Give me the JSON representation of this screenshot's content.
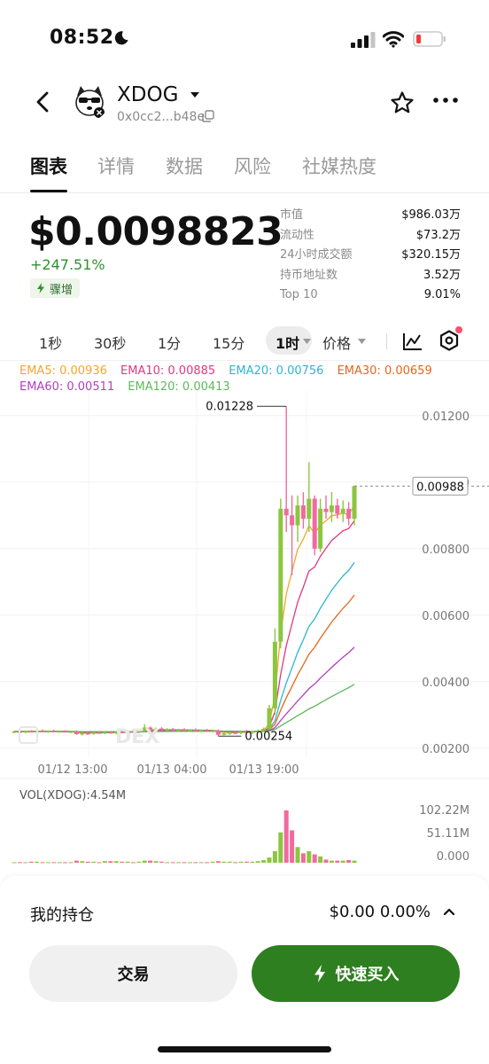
{
  "status_bar": {
    "time": "08:52"
  },
  "header": {
    "token_name": "XDOG",
    "address": "0x0cc2...b48e"
  },
  "tabs": [
    {
      "label": "图表",
      "active": true
    },
    {
      "label": "详情",
      "active": false
    },
    {
      "label": "数据",
      "active": false
    },
    {
      "label": "风险",
      "active": false
    },
    {
      "label": "社媒热度",
      "active": false
    }
  ],
  "price": {
    "value": "$0.0098823",
    "change": "+247.51%",
    "badge": "骤增"
  },
  "stats": [
    {
      "label": "市值",
      "value": "$986.03万"
    },
    {
      "label": "流动性",
      "value": "$73.2万"
    },
    {
      "label": "24小时成交额",
      "value": "$320.15万"
    },
    {
      "label": "持币地址数",
      "value": "3.52万"
    },
    {
      "label": "Top 10",
      "value": "9.01%"
    }
  ],
  "intervals": [
    "1秒",
    "30秒",
    "1分",
    "15分",
    "1时"
  ],
  "selected_interval": "1时",
  "price_mode": "价格",
  "ema_legend": [
    {
      "label": "EMA5: 0.00936",
      "color": "#f2a62a"
    },
    {
      "label": "EMA10: 0.00885",
      "color": "#e2387e"
    },
    {
      "label": "EMA20: 0.00756",
      "color": "#2bb7d0"
    },
    {
      "label": "EMA30: 0.00659",
      "color": "#e8651a"
    },
    {
      "label": "EMA60: 0.00511",
      "color": "#b13fbd"
    },
    {
      "label": "EMA120: 0.00413",
      "color": "#5fb85a"
    }
  ],
  "chart": {
    "price_axis": [
      "0.01200",
      "0.01000",
      "0.00800",
      "0.00600",
      "0.00400",
      "0.00200"
    ],
    "time_axis": [
      "01/12 13:00",
      "01/13 04:00",
      "01/13 19:00"
    ],
    "high_label": "0.01228",
    "low_label": "0.00254",
    "current_price": "0.00988",
    "watermark": "DEX",
    "vol_label": "VOL(XDOG):4.54M",
    "vol_axis": [
      "102.22M",
      "51.11M",
      "0.000"
    ]
  },
  "chart_data": {
    "type": "candlestick",
    "ylim": [
      0.0017,
      0.0125
    ],
    "price_ticks": [
      0.012,
      0.01,
      0.008,
      0.006,
      0.004,
      0.002
    ],
    "up_color": "#8cc63f",
    "down_color": "#f06aa0",
    "candles": [
      {
        "o": 0.00248,
        "h": 0.00252,
        "l": 0.00245,
        "c": 0.0025,
        "v": 1
      },
      {
        "o": 0.0025,
        "h": 0.00254,
        "l": 0.00246,
        "c": 0.00249,
        "v": 1
      },
      {
        "o": 0.00249,
        "h": 0.00253,
        "l": 0.00245,
        "c": 0.00251,
        "v": 1
      },
      {
        "o": 0.00251,
        "h": 0.00254,
        "l": 0.00247,
        "c": 0.00248,
        "v": 2
      },
      {
        "o": 0.00248,
        "h": 0.00255,
        "l": 0.00247,
        "c": 0.00253,
        "v": 2
      },
      {
        "o": 0.00253,
        "h": 0.00256,
        "l": 0.00249,
        "c": 0.0025,
        "v": 1
      },
      {
        "o": 0.0025,
        "h": 0.00254,
        "l": 0.00246,
        "c": 0.00252,
        "v": 1
      },
      {
        "o": 0.00252,
        "h": 0.00255,
        "l": 0.00248,
        "c": 0.00249,
        "v": 1
      },
      {
        "o": 0.00249,
        "h": 0.00252,
        "l": 0.00246,
        "c": 0.00251,
        "v": 1
      },
      {
        "o": 0.00251,
        "h": 0.00254,
        "l": 0.00247,
        "c": 0.00248,
        "v": 1
      },
      {
        "o": 0.00248,
        "h": 0.00252,
        "l": 0.00245,
        "c": 0.0025,
        "v": 1
      },
      {
        "o": 0.0025,
        "h": 0.00253,
        "l": 0.0024,
        "c": 0.00242,
        "v": 4
      },
      {
        "o": 0.00242,
        "h": 0.00248,
        "l": 0.00238,
        "c": 0.00245,
        "v": 3
      },
      {
        "o": 0.00245,
        "h": 0.0025,
        "l": 0.0024,
        "c": 0.00243,
        "v": 2
      },
      {
        "o": 0.00243,
        "h": 0.00249,
        "l": 0.0024,
        "c": 0.00247,
        "v": 2
      },
      {
        "o": 0.00247,
        "h": 0.0025,
        "l": 0.00243,
        "c": 0.00245,
        "v": 1
      },
      {
        "o": 0.00245,
        "h": 0.00249,
        "l": 0.00242,
        "c": 0.00248,
        "v": 3
      },
      {
        "o": 0.00248,
        "h": 0.00251,
        "l": 0.00244,
        "c": 0.00246,
        "v": 3
      },
      {
        "o": 0.00246,
        "h": 0.0025,
        "l": 0.00242,
        "c": 0.00249,
        "v": 3
      },
      {
        "o": 0.00249,
        "h": 0.00252,
        "l": 0.00245,
        "c": 0.00247,
        "v": 2
      },
      {
        "o": 0.00247,
        "h": 0.00251,
        "l": 0.00244,
        "c": 0.0025,
        "v": 2
      },
      {
        "o": 0.0025,
        "h": 0.00254,
        "l": 0.00246,
        "c": 0.00248,
        "v": 1
      },
      {
        "o": 0.00248,
        "h": 0.00253,
        "l": 0.00245,
        "c": 0.00252,
        "v": 2
      },
      {
        "o": 0.00252,
        "h": 0.00272,
        "l": 0.00248,
        "c": 0.00262,
        "v": 4
      },
      {
        "o": 0.00262,
        "h": 0.00265,
        "l": 0.00252,
        "c": 0.00256,
        "v": 4
      },
      {
        "o": 0.00256,
        "h": 0.00262,
        "l": 0.0025,
        "c": 0.00259,
        "v": 3
      },
      {
        "o": 0.00259,
        "h": 0.00263,
        "l": 0.00252,
        "c": 0.00255,
        "v": 2
      },
      {
        "o": 0.00255,
        "h": 0.0026,
        "l": 0.0025,
        "c": 0.00257,
        "v": 1
      },
      {
        "o": 0.00257,
        "h": 0.00261,
        "l": 0.00252,
        "c": 0.00254,
        "v": 1
      },
      {
        "o": 0.00254,
        "h": 0.00258,
        "l": 0.0025,
        "c": 0.00256,
        "v": 1
      },
      {
        "o": 0.00256,
        "h": 0.0026,
        "l": 0.00251,
        "c": 0.00253,
        "v": 1
      },
      {
        "o": 0.00253,
        "h": 0.00257,
        "l": 0.00249,
        "c": 0.00255,
        "v": 1
      },
      {
        "o": 0.00255,
        "h": 0.00259,
        "l": 0.0025,
        "c": 0.00252,
        "v": 1
      },
      {
        "o": 0.00252,
        "h": 0.00256,
        "l": 0.00248,
        "c": 0.00254,
        "v": 1
      },
      {
        "o": 0.00254,
        "h": 0.00258,
        "l": 0.00249,
        "c": 0.00251,
        "v": 1
      },
      {
        "o": 0.00251,
        "h": 0.00255,
        "l": 0.00247,
        "c": 0.00253,
        "v": 2
      },
      {
        "o": 0.00253,
        "h": 0.00256,
        "l": 0.00236,
        "c": 0.0024,
        "v": 3
      },
      {
        "o": 0.0024,
        "h": 0.0025,
        "l": 0.00238,
        "c": 0.00244,
        "v": 2
      },
      {
        "o": 0.00244,
        "h": 0.0025,
        "l": 0.0024,
        "c": 0.00247,
        "v": 2
      },
      {
        "o": 0.00247,
        "h": 0.00251,
        "l": 0.00242,
        "c": 0.00245,
        "v": 1
      },
      {
        "o": 0.00245,
        "h": 0.00252,
        "l": 0.00242,
        "c": 0.0025,
        "v": 2
      },
      {
        "o": 0.0025,
        "h": 0.00255,
        "l": 0.00244,
        "c": 0.00246,
        "v": 2
      },
      {
        "o": 0.00246,
        "h": 0.00252,
        "l": 0.00242,
        "c": 0.00251,
        "v": 2
      },
      {
        "o": 0.00251,
        "h": 0.00256,
        "l": 0.00246,
        "c": 0.00253,
        "v": 3
      },
      {
        "o": 0.00253,
        "h": 0.00262,
        "l": 0.00248,
        "c": 0.00258,
        "v": 5
      },
      {
        "o": 0.00258,
        "h": 0.0033,
        "l": 0.00255,
        "c": 0.0032,
        "v": 10
      },
      {
        "o": 0.0032,
        "h": 0.0056,
        "l": 0.003,
        "c": 0.0052,
        "v": 22
      },
      {
        "o": 0.0052,
        "h": 0.0095,
        "l": 0.005,
        "c": 0.0092,
        "v": 58
      },
      {
        "o": 0.0092,
        "h": 0.01228,
        "l": 0.0085,
        "c": 0.009,
        "v": 100
      },
      {
        "o": 0.009,
        "h": 0.0096,
        "l": 0.0072,
        "c": 0.0087,
        "v": 62
      },
      {
        "o": 0.0087,
        "h": 0.0096,
        "l": 0.0082,
        "c": 0.0093,
        "v": 30
      },
      {
        "o": 0.0093,
        "h": 0.0097,
        "l": 0.0086,
        "c": 0.0089,
        "v": 18
      },
      {
        "o": 0.0089,
        "h": 0.0106,
        "l": 0.0085,
        "c": 0.0095,
        "v": 22
      },
      {
        "o": 0.0095,
        "h": 0.0096,
        "l": 0.0078,
        "c": 0.008,
        "v": 16
      },
      {
        "o": 0.008,
        "h": 0.0095,
        "l": 0.0079,
        "c": 0.0092,
        "v": 12
      },
      {
        "o": 0.0092,
        "h": 0.0096,
        "l": 0.0089,
        "c": 0.0091,
        "v": 6
      },
      {
        "o": 0.0091,
        "h": 0.0097,
        "l": 0.0088,
        "c": 0.0093,
        "v": 4
      },
      {
        "o": 0.0093,
        "h": 0.0095,
        "l": 0.0089,
        "c": 0.00905,
        "v": 4
      },
      {
        "o": 0.00905,
        "h": 0.00945,
        "l": 0.0088,
        "c": 0.0092,
        "v": 4
      },
      {
        "o": 0.0092,
        "h": 0.0094,
        "l": 0.0087,
        "c": 0.0089,
        "v": 5
      },
      {
        "o": 0.0089,
        "h": 0.0099,
        "l": 0.0087,
        "c": 0.00988,
        "v": 4
      }
    ]
  },
  "position": {
    "label": "我的持仓",
    "value": "$0.00 0.00%"
  },
  "buttons": {
    "trade": "交易",
    "quick_buy": "快速买入"
  }
}
